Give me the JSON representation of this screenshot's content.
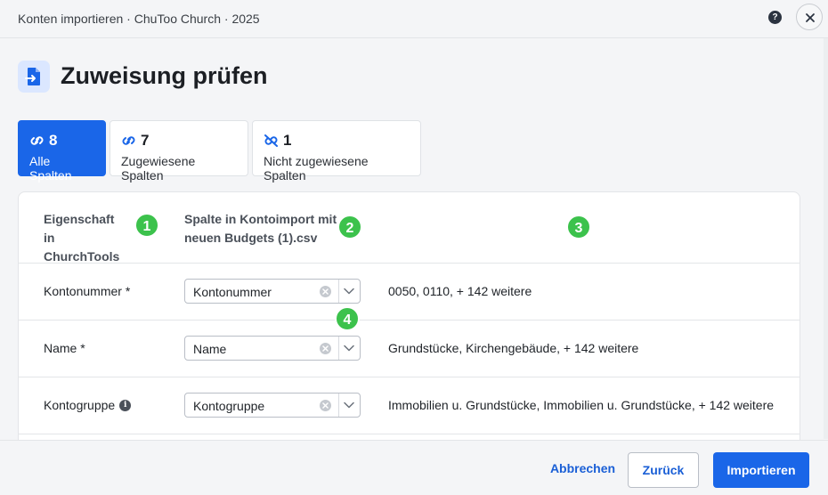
{
  "header": {
    "title": "Konten importieren · ChuToo Church · 2025",
    "help_label": "?"
  },
  "page": {
    "title": "Zuweisung prüfen"
  },
  "tabs": [
    {
      "count": "8",
      "label": "Alle Spalten",
      "active": true
    },
    {
      "count": "7",
      "label": "Zugewiesene Spalten",
      "active": false
    },
    {
      "count": "1",
      "label": "Nicht zugewiesene Spalten",
      "active": false
    }
  ],
  "table": {
    "header_property": "Eigenschaft in ChurchTools",
    "header_column": "Spalte in Kontoimport mit neuen Budgets (1).csv",
    "rows": [
      {
        "property": "Kontonummer *",
        "selected": "Kontonummer",
        "preview": "0050, 0110, + 142 weitere"
      },
      {
        "property": "Name *",
        "selected": "Name",
        "preview": "Grundstücke, Kirchengebäude, + 142 weitere"
      },
      {
        "property": "Kontogruppe",
        "selected": "Kontogruppe",
        "preview": "Immobilien u. Grundstücke, Immobilien u. Grundstücke, + 142 weitere"
      }
    ]
  },
  "markers": [
    "1",
    "2",
    "3",
    "4"
  ],
  "info_icon_glyph": "i",
  "footer": {
    "cancel_label": "Abbrechen",
    "back_label": "Zurück",
    "import_label": "Importieren"
  },
  "colors": {
    "accent": "#1a66e8",
    "marker": "#3cc24c"
  }
}
